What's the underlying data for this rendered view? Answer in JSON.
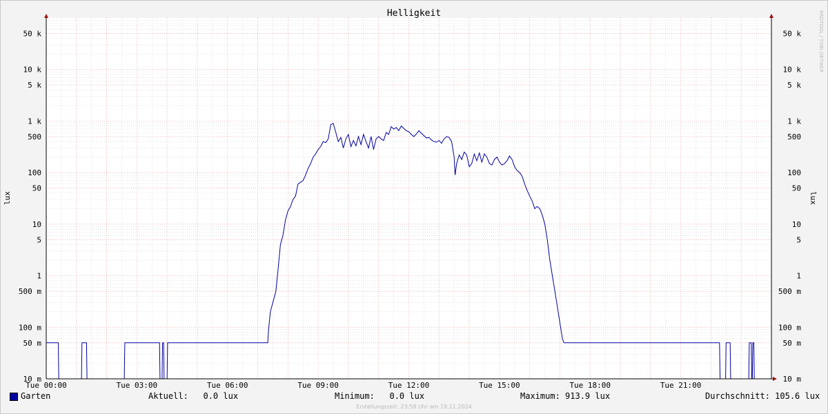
{
  "chart_data": {
    "type": "line",
    "title": "Helligkeit",
    "ylabel": "lux",
    "y_scale": "log",
    "ylim": [
      0.01,
      100000
    ],
    "y_ticks": [
      {
        "v": 0.01,
        "label": "10 m"
      },
      {
        "v": 0.05,
        "label": "50 m"
      },
      {
        "v": 0.1,
        "label": "100 m"
      },
      {
        "v": 0.5,
        "label": "500 m"
      },
      {
        "v": 1,
        "label": "1"
      },
      {
        "v": 5,
        "label": "5"
      },
      {
        "v": 10,
        "label": "10"
      },
      {
        "v": 50,
        "label": "50"
      },
      {
        "v": 100,
        "label": "100"
      },
      {
        "v": 500,
        "label": "500"
      },
      {
        "v": 1000,
        "label": "1 k"
      },
      {
        "v": 5000,
        "label": "5 k"
      },
      {
        "v": 10000,
        "label": "10 k"
      },
      {
        "v": 50000,
        "label": "50 k"
      }
    ],
    "x_range": [
      "00:00",
      "24:00"
    ],
    "x_ticks": [
      "Tue 00:00",
      "Tue 03:00",
      "Tue 06:00",
      "Tue 09:00",
      "Tue 12:00",
      "Tue 15:00",
      "Tue 18:00",
      "Tue 21:00"
    ],
    "grid": true,
    "series": [
      {
        "name": "Garten",
        "color": "#0000a0",
        "points": [
          [
            "00:00",
            0.05
          ],
          [
            "00:24",
            0.05
          ],
          [
            "00:25",
            0.01
          ],
          [
            "01:10",
            0.01
          ],
          [
            "01:11",
            0.05
          ],
          [
            "01:20",
            0.05
          ],
          [
            "01:21",
            0.01
          ],
          [
            "02:35",
            0.01
          ],
          [
            "02:36",
            0.05
          ],
          [
            "03:45",
            0.05
          ],
          [
            "03:46",
            0.01
          ],
          [
            "03:50",
            0.01
          ],
          [
            "03:51",
            0.05
          ],
          [
            "03:53",
            0.05
          ],
          [
            "03:54",
            0.01
          ],
          [
            "04:00",
            0.01
          ],
          [
            "04:01",
            0.05
          ],
          [
            "07:20",
            0.05
          ],
          [
            "07:21",
            0.08
          ],
          [
            "07:25",
            0.2
          ],
          [
            "07:30",
            0.3
          ],
          [
            "07:36",
            0.5
          ],
          [
            "07:40",
            1.2
          ],
          [
            "07:45",
            4
          ],
          [
            "07:50",
            6
          ],
          [
            "07:55",
            12
          ],
          [
            "08:00",
            18
          ],
          [
            "08:05",
            22
          ],
          [
            "08:10",
            30
          ],
          [
            "08:15",
            35
          ],
          [
            "08:20",
            60
          ],
          [
            "08:30",
            70
          ],
          [
            "08:35",
            90
          ],
          [
            "08:40",
            120
          ],
          [
            "08:45",
            150
          ],
          [
            "08:50",
            200
          ],
          [
            "08:55",
            230
          ],
          [
            "09:00",
            280
          ],
          [
            "09:05",
            320
          ],
          [
            "09:10",
            400
          ],
          [
            "09:15",
            380
          ],
          [
            "09:20",
            450
          ],
          [
            "09:25",
            850
          ],
          [
            "09:30",
            900
          ],
          [
            "09:35",
            600
          ],
          [
            "09:40",
            400
          ],
          [
            "09:45",
            480
          ],
          [
            "09:50",
            300
          ],
          [
            "09:55",
            450
          ],
          [
            "10:00",
            550
          ],
          [
            "10:05",
            320
          ],
          [
            "10:10",
            420
          ],
          [
            "10:15",
            330
          ],
          [
            "10:20",
            500
          ],
          [
            "10:25",
            350
          ],
          [
            "10:30",
            550
          ],
          [
            "10:35",
            400
          ],
          [
            "10:40",
            300
          ],
          [
            "10:45",
            500
          ],
          [
            "10:50",
            280
          ],
          [
            "10:55",
            450
          ],
          [
            "11:00",
            500
          ],
          [
            "11:05",
            450
          ],
          [
            "11:10",
            420
          ],
          [
            "11:15",
            600
          ],
          [
            "11:20",
            550
          ],
          [
            "11:25",
            780
          ],
          [
            "11:30",
            700
          ],
          [
            "11:35",
            750
          ],
          [
            "11:40",
            650
          ],
          [
            "11:45",
            800
          ],
          [
            "11:50",
            720
          ],
          [
            "11:55",
            650
          ],
          [
            "12:00",
            620
          ],
          [
            "12:05",
            550
          ],
          [
            "12:10",
            500
          ],
          [
            "12:15",
            560
          ],
          [
            "12:20",
            650
          ],
          [
            "12:25",
            580
          ],
          [
            "12:30",
            520
          ],
          [
            "12:35",
            470
          ],
          [
            "12:40",
            480
          ],
          [
            "12:45",
            430
          ],
          [
            "12:50",
            400
          ],
          [
            "12:55",
            390
          ],
          [
            "13:00",
            420
          ],
          [
            "13:05",
            370
          ],
          [
            "13:10",
            450
          ],
          [
            "13:15",
            500
          ],
          [
            "13:20",
            480
          ],
          [
            "13:25",
            400
          ],
          [
            "13:30",
            200
          ],
          [
            "13:32",
            90
          ],
          [
            "13:35",
            150
          ],
          [
            "13:40",
            220
          ],
          [
            "13:45",
            180
          ],
          [
            "13:50",
            250
          ],
          [
            "13:55",
            220
          ],
          [
            "14:00",
            130
          ],
          [
            "14:05",
            150
          ],
          [
            "14:10",
            230
          ],
          [
            "14:15",
            170
          ],
          [
            "14:20",
            240
          ],
          [
            "14:25",
            160
          ],
          [
            "14:30",
            230
          ],
          [
            "14:35",
            200
          ],
          [
            "14:40",
            150
          ],
          [
            "14:45",
            140
          ],
          [
            "14:50",
            180
          ],
          [
            "14:55",
            200
          ],
          [
            "15:00",
            160
          ],
          [
            "15:05",
            140
          ],
          [
            "15:10",
            150
          ],
          [
            "15:15",
            170
          ],
          [
            "15:20",
            210
          ],
          [
            "15:25",
            180
          ],
          [
            "15:30",
            130
          ],
          [
            "15:35",
            110
          ],
          [
            "15:40",
            100
          ],
          [
            "15:45",
            85
          ],
          [
            "15:50",
            60
          ],
          [
            "15:55",
            45
          ],
          [
            "16:00",
            35
          ],
          [
            "16:05",
            28
          ],
          [
            "16:10",
            20
          ],
          [
            "16:15",
            22
          ],
          [
            "16:20",
            20
          ],
          [
            "16:25",
            15
          ],
          [
            "16:30",
            10
          ],
          [
            "16:35",
            5
          ],
          [
            "16:40",
            2
          ],
          [
            "16:45",
            1
          ],
          [
            "16:50",
            0.5
          ],
          [
            "16:55",
            0.25
          ],
          [
            "17:00",
            0.12
          ],
          [
            "17:05",
            0.06
          ],
          [
            "17:08",
            0.05
          ],
          [
            "22:17",
            0.05
          ],
          [
            "22:18",
            0.01
          ],
          [
            "22:29",
            0.01
          ],
          [
            "22:30",
            0.05
          ],
          [
            "22:38",
            0.05
          ],
          [
            "22:39",
            0.01
          ],
          [
            "23:15",
            0.01
          ],
          [
            "23:16",
            0.05
          ],
          [
            "23:20",
            0.05
          ],
          [
            "23:21",
            0.01
          ],
          [
            "23:22",
            0.01
          ],
          [
            "23:23",
            0.05
          ],
          [
            "23:25",
            0.05
          ],
          [
            "23:26",
            0.01
          ],
          [
            "24:00",
            0.01
          ]
        ]
      }
    ]
  },
  "legend": {
    "series_name": "Garten",
    "current_label": "Aktuell:",
    "current_value": "0.0 lux",
    "min_label": "Minimum:",
    "min_value": "0.0 lux",
    "max_label": "Maximum:",
    "max_value": "913.9 lux",
    "avg_label": "Durchschnitt:",
    "avg_value": "105.6 lux"
  },
  "footer": "Erstellungszeit: 23:58 Uhr am 19.11.2024",
  "watermark": "RRDTOOL / TOBI OETIKER"
}
